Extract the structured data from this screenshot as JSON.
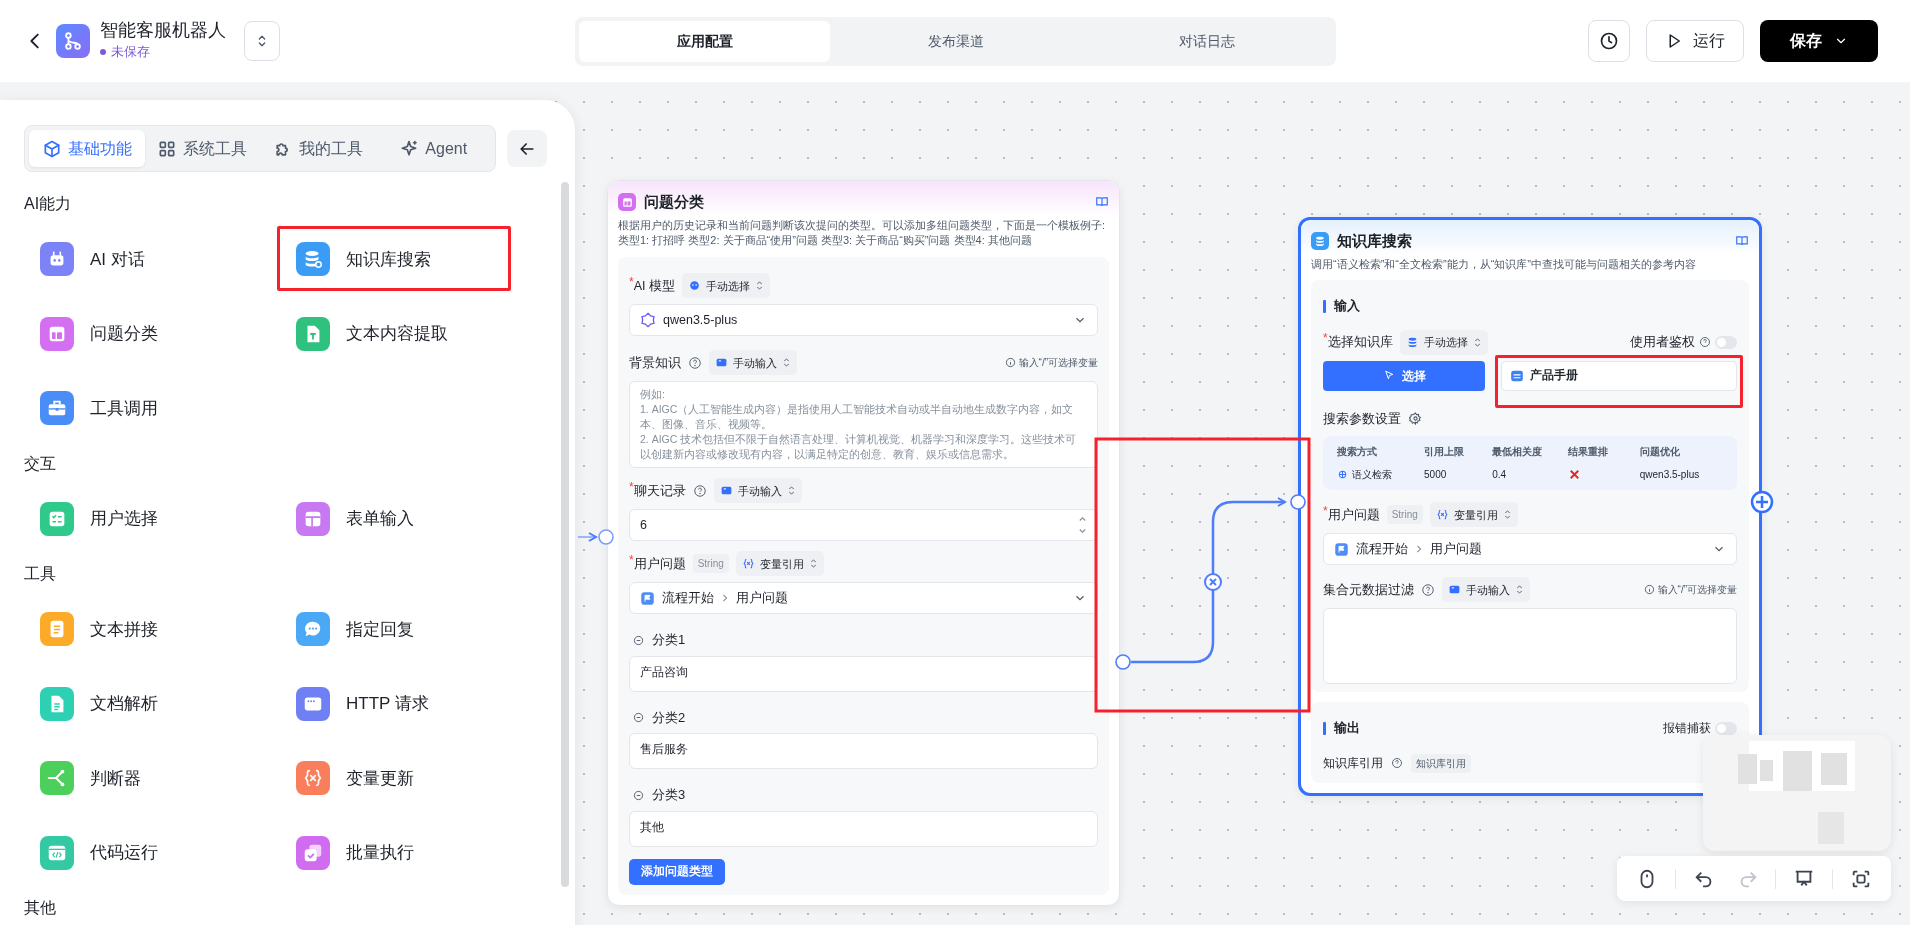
{
  "header": {
    "title": "智能客服机器人",
    "status": "未保存",
    "tabs": [
      {
        "label": "应用配置",
        "selected": true
      },
      {
        "label": "发布渠道",
        "selected": false
      },
      {
        "label": "对话日志",
        "selected": false
      }
    ],
    "run_label": "运行",
    "save_label": "保存"
  },
  "sidebar": {
    "tabs": [
      {
        "label": "基础功能",
        "selected": true
      },
      {
        "label": "系统工具",
        "selected": false
      },
      {
        "label": "我的工具",
        "selected": false
      },
      {
        "label": "Agent",
        "selected": false
      }
    ],
    "sections": [
      {
        "title": "AI能力",
        "items": [
          {
            "label": "AI 对话",
            "color": "#7c83f7",
            "highlighted": false
          },
          {
            "label": "知识库搜索",
            "color": "#3b9cf6",
            "highlighted": true
          },
          {
            "label": "问题分类",
            "color": "#d36ff0",
            "highlighted": false
          },
          {
            "label": "文本内容提取",
            "color": "#2fc27f",
            "highlighted": false
          },
          {
            "label": "工具调用",
            "color": "#4b8df6",
            "highlighted": false
          }
        ]
      },
      {
        "title": "交互",
        "items": [
          {
            "label": "用户选择",
            "color": "#2fca8b",
            "highlighted": false
          },
          {
            "label": "表单输入",
            "color": "#c878f0",
            "highlighted": false
          }
        ]
      },
      {
        "title": "工具",
        "items": [
          {
            "label": "文本拼接",
            "color": "#fbab28",
            "highlighted": false
          },
          {
            "label": "指定回复",
            "color": "#4aa8f7",
            "highlighted": false
          },
          {
            "label": "文档解析",
            "color": "#2ed0b4",
            "highlighted": false
          },
          {
            "label": "HTTP 请求",
            "color": "#6f80f5",
            "highlighted": false
          },
          {
            "label": "判断器",
            "color": "#4ccf5b",
            "highlighted": false
          },
          {
            "label": "变量更新",
            "color": "#f97f5c",
            "highlighted": false
          },
          {
            "label": "代码运行",
            "color": "#33c9a3",
            "highlighted": false
          },
          {
            "label": "批量执行",
            "color": "#d06cf0",
            "highlighted": false
          }
        ]
      },
      {
        "title": "其他"
      }
    ]
  },
  "nodes": [
    {
      "kind": "classifier",
      "selected": false,
      "title": "问题分类",
      "description": "根据用户的历史记录和当前问题判断该次提问的类型。可以添加多组问题类型，下面是一个模板例子: 类型1: 打招呼 类型2: 关于商品“使用”问题 类型3: 关于商品“购买”问题 类型4: 其他问题",
      "model": {
        "label": "$^{*}$AI 模型",
        "mode": "手动选择",
        "value": "qwen3.5-plus"
      },
      "background": {
        "label": "背景知识",
        "mode": "手动输入",
        "hint": "输入“/”可选择变量",
        "placeholder": "例如:\n1. AIGC（人工智能生成内容）是指使用人工智能技术自动或半自动地生成数字内容，如文本、图像、音乐、视频等。\n2. AIGC 技术包括但不限于自然语言处理、计算机视觉、机器学习和深度学习。这些技术可以创建新内容或修改现有内容，以满足特定的创意、教育、娱乐或信息需求。"
      },
      "history": {
        "label": "$^{*}$聊天记录",
        "mode": "手动输入",
        "value": "6"
      },
      "question": {
        "label": "$^{*}$用户问题",
        "type": "String",
        "mode": "变量引用",
        "path": [
          "流程开始",
          "用户问题"
        ]
      },
      "categories": [
        {
          "label": "分类1",
          "value": "产品咨询"
        },
        {
          "label": "分类2",
          "value": "售后服务"
        },
        {
          "label": "分类3",
          "value": "其他"
        }
      ],
      "add_label": "添加问题类型"
    },
    {
      "kind": "knowledge_search",
      "selected": true,
      "title": "知识库搜索",
      "description": "调用“语义检索”和“全文检索”能力，从“知识库”中查找可能与问题相关的参考内容",
      "input_title": "输入",
      "dataset": {
        "label": "$^{*}$选择知识库",
        "mode": "手动选择",
        "auth_label": "使用者鉴权",
        "auth_on": false,
        "select_label": "选择",
        "items": [
          {
            "label": "产品手册",
            "highlighted": true
          }
        ]
      },
      "search": {
        "title": "搜索参数设置",
        "columns": [
          "搜索方式",
          "引用上限",
          "最低相关度",
          "结果重排",
          "问题优化"
        ],
        "method": "语义检索",
        "limit": "5000",
        "similarity": "0.4",
        "rerank": false,
        "optimizer": "qwen3.5-plus"
      },
      "question": {
        "label": "$^{*}$用户问题",
        "type": "String",
        "mode": "变量引用",
        "path": [
          "流程开始",
          "用户问题"
        ]
      },
      "filter": {
        "label": "集合元数据过滤",
        "mode": "手动输入",
        "hint": "输入“/”可选择变量"
      },
      "output_title": "输出",
      "catch_label": "报错捕获",
      "catch_on": false,
      "outputs": [
        {
          "label": "知识库引用",
          "tag": "知识库引用"
        }
      ]
    }
  ],
  "connection": {
    "highlighted": true
  },
  "toolbar": [
    {
      "disabled": false
    },
    {
      "disabled": false
    },
    {
      "disabled": true
    },
    {
      "disabled": false
    },
    {
      "disabled": false
    }
  ]
}
